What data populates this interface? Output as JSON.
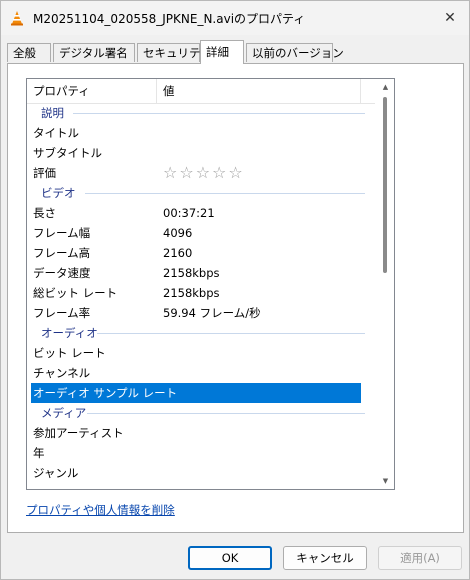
{
  "window": {
    "title": "M20251104_020558_JPKNE_N.aviのプロパティ",
    "close_glyph": "✕"
  },
  "tabs": [
    {
      "label": "全般"
    },
    {
      "label": "デジタル署名"
    },
    {
      "label": "セキュリティ"
    },
    {
      "label": "詳細",
      "active": true
    },
    {
      "label": "以前のバージョン"
    }
  ],
  "details": {
    "columns": {
      "property": "プロパティ",
      "value": "値"
    },
    "groups": {
      "description": "説明",
      "video": "ビデオ",
      "audio": "オーディオ",
      "media": "メディア"
    },
    "rows": {
      "title": {
        "name": "タイトル",
        "value": ""
      },
      "subtitle": {
        "name": "サブタイトル",
        "value": ""
      },
      "rating": {
        "name": "評価",
        "stars": "☆☆☆☆☆"
      },
      "length": {
        "name": "長さ",
        "value": "00:37:21"
      },
      "frame_width": {
        "name": "フレーム幅",
        "value": "4096"
      },
      "frame_height": {
        "name": "フレーム高",
        "value": "2160"
      },
      "data_rate": {
        "name": "データ速度",
        "value": "2158kbps"
      },
      "total_bitrate": {
        "name": "総ビット レート",
        "value": "2158kbps"
      },
      "frame_rate": {
        "name": "フレーム率",
        "value": "59.94 フレーム/秒"
      },
      "audio_bitrate": {
        "name": "ビット レート",
        "value": ""
      },
      "channels": {
        "name": "チャンネル",
        "value": ""
      },
      "sample_rate": {
        "name": "オーディオ サンプル レート",
        "value": ""
      },
      "contributing_artist": {
        "name": "参加アーティスト",
        "value": ""
      },
      "year": {
        "name": "年",
        "value": ""
      },
      "genre": {
        "name": "ジャンル",
        "value": ""
      }
    }
  },
  "links": {
    "remove_properties": "プロパティや個人情報を削除"
  },
  "buttons": {
    "ok": "OK",
    "cancel": "キャンセル",
    "apply": "適用(A)"
  },
  "colors": {
    "accent": "#0078d7",
    "group_header": "#1e3287",
    "link": "#0645ad"
  }
}
